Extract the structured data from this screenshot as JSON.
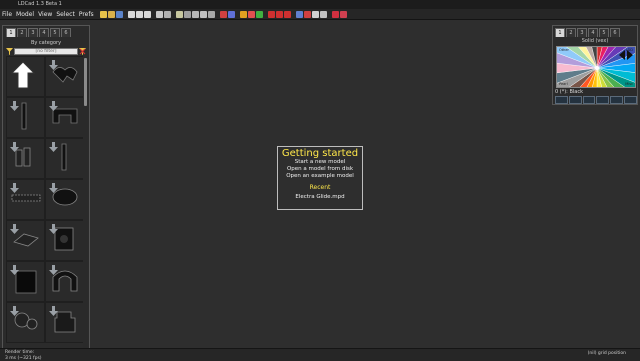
{
  "window": {
    "title": "LDCad 1.3 Beta 1"
  },
  "menu": [
    "File",
    "Model",
    "View",
    "Select",
    "Prefs"
  ],
  "toolbar": {
    "icons": [
      {
        "name": "new-file-icon",
        "color": "#e8c34a"
      },
      {
        "name": "open-file-icon",
        "color": "#d9b04a"
      },
      {
        "name": "save-file-icon",
        "color": "#5a82c8"
      },
      {
        "name": "sep"
      },
      {
        "name": "undo-icon",
        "color": "#d8d8d8"
      },
      {
        "name": "redo-icon",
        "color": "#d8d8d8"
      },
      {
        "name": "copy-icon",
        "color": "#d8d8d8"
      },
      {
        "name": "sep"
      },
      {
        "name": "select-icon",
        "color": "#c8c8c8"
      },
      {
        "name": "group-icon",
        "color": "#b0b0b0"
      },
      {
        "name": "sep"
      },
      {
        "name": "edit-mode-icon",
        "color": "#c8c8a0"
      },
      {
        "name": "snap-icon",
        "color": "#a0a0a0"
      },
      {
        "name": "grid-icon",
        "color": "#b8b8b8"
      },
      {
        "name": "view-icon",
        "color": "#c0c0c0"
      },
      {
        "name": "camera-icon",
        "color": "#a8a8a8"
      },
      {
        "name": "sep"
      },
      {
        "name": "color-picker-icon",
        "color": "#d04040"
      },
      {
        "name": "brick-icon",
        "color": "#6070d8"
      },
      {
        "name": "sep"
      },
      {
        "name": "move-x-icon",
        "color": "#e0a020"
      },
      {
        "name": "move-y-icon",
        "color": "#e05050"
      },
      {
        "name": "move-z-icon",
        "color": "#40b040"
      },
      {
        "name": "sep"
      },
      {
        "name": "rotate-x-icon",
        "color": "#d03030"
      },
      {
        "name": "rotate-y-icon",
        "color": "#d03030"
      },
      {
        "name": "rotate-z-icon",
        "color": "#d03030"
      },
      {
        "name": "sep"
      },
      {
        "name": "pivot-icon",
        "color": "#6080d0"
      },
      {
        "name": "target-icon",
        "color": "#d04040"
      },
      {
        "name": "rotate-icon",
        "color": "#d0d0d0"
      },
      {
        "name": "fit-icon",
        "color": "#c0c0c0"
      },
      {
        "name": "sep"
      },
      {
        "name": "flag-icon",
        "color": "#d03040"
      },
      {
        "name": "heart-icon",
        "color": "#d04050"
      }
    ]
  },
  "left_panel": {
    "tabs": [
      "1",
      "2",
      "3",
      "4",
      "5",
      "6"
    ],
    "active_tab": "1",
    "category_label": "By category",
    "filter_placeholder": "[no filter]",
    "parts": [
      {
        "name": "part-arrow"
      },
      {
        "name": "part-animal"
      },
      {
        "name": "part-bar"
      },
      {
        "name": "part-bracket"
      },
      {
        "name": "part-technic-pin"
      },
      {
        "name": "part-axle"
      },
      {
        "name": "part-chain"
      },
      {
        "name": "part-wheel"
      },
      {
        "name": "part-antenna"
      },
      {
        "name": "part-panel"
      },
      {
        "name": "part-box"
      },
      {
        "name": "part-arch"
      },
      {
        "name": "part-gear-cluster"
      },
      {
        "name": "part-figure"
      }
    ]
  },
  "getting_started": {
    "title": "Getting started",
    "links": [
      "Start a new model",
      "Open a model from disk",
      "Open an example model"
    ],
    "recent_label": "Recent",
    "recent_files": [
      "Electra Glide.mpd"
    ]
  },
  "right_panel": {
    "tabs": [
      "1",
      "2",
      "3",
      "4",
      "5",
      "6"
    ],
    "active_tab": "1",
    "label": "Solid (vex)",
    "corner_labels": [
      "Other",
      "LDD",
      "Pearl",
      "Misc"
    ],
    "selected_color": "0 (*): Black",
    "wheel_colors": [
      "#d32f2f",
      "#e91e63",
      "#9c27b0",
      "#673ab7",
      "#3f51b5",
      "#2196f3",
      "#03a9f4",
      "#00bcd4",
      "#009688",
      "#4caf50",
      "#8bc34a",
      "#cddc39",
      "#ffeb3b",
      "#ffc107",
      "#ff9800",
      "#ff5722",
      "#795548",
      "#9e9e9e",
      "#607d8b",
      "#f8bbd0",
      "#b39ddb",
      "#90caf9",
      "#a5d6a7",
      "#fff59d",
      "#bcaaa4",
      "#424242"
    ]
  },
  "status": {
    "render_label": "Render time:",
    "render_value": "3 ms (~321 fps)",
    "grid_position": "(nil) grid position"
  },
  "colors": {
    "viewport_bg": "#2e2e2e",
    "accent_yellow": "#ffe84a",
    "panel_bg": "#2b2b2b"
  }
}
